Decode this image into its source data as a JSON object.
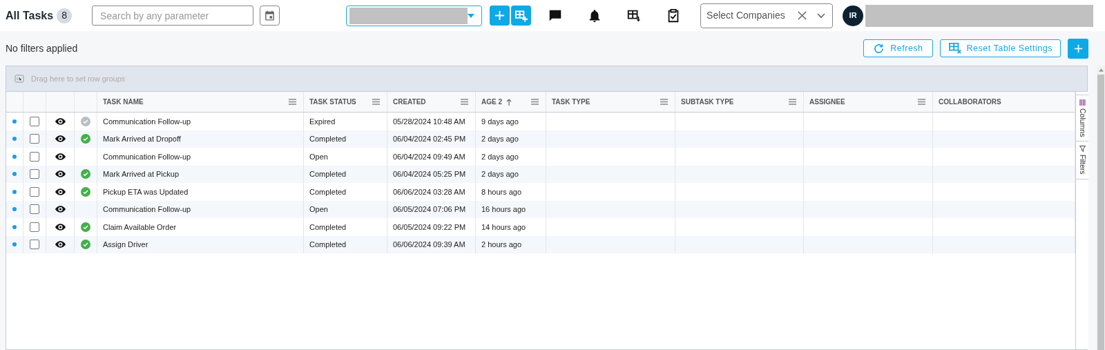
{
  "header": {
    "title": "All Tasks",
    "count": "8",
    "search": {
      "placeholder": "Search by any parameter"
    },
    "companies": {
      "placeholder": "Select Companies"
    },
    "avatar": "IR"
  },
  "toolbar": {
    "filter_status": "No filters applied",
    "buttons": [
      "Refresh",
      "Reset Table Settings"
    ]
  },
  "grid": {
    "group_hint": "Drag here to set row groups",
    "columns": [
      {
        "label": "TASK NAME",
        "sorted": false,
        "menu": true
      },
      {
        "label": "TASK STATUS",
        "sorted": false,
        "menu": true
      },
      {
        "label": "CREATED",
        "sorted": false,
        "menu": true
      },
      {
        "label": "AGE 2",
        "sorted": true,
        "menu": true
      },
      {
        "label": "TASK TYPE",
        "sorted": false,
        "menu": true
      },
      {
        "label": "SUBTASK TYPE",
        "sorted": false,
        "menu": true
      },
      {
        "label": "ASSIGNEE",
        "sorted": false,
        "menu": true
      },
      {
        "label": "COLLABORATORS",
        "sorted": false,
        "menu": false
      }
    ],
    "rows": [
      {
        "checked": false,
        "kind": "expired",
        "cells": [
          "Communication Follow-up",
          "Expired",
          "05/28/2024 10:48 AM",
          "9 days ago"
        ]
      },
      {
        "checked": false,
        "kind": "done",
        "cells": [
          "Mark Arrived at Dropoff",
          "Completed",
          "06/04/2024 02:45 PM",
          "2 days ago"
        ]
      },
      {
        "checked": false,
        "kind": "none",
        "cells": [
          "Communication Follow-up",
          "Open",
          "06/04/2024 09:49 AM",
          "2 days ago"
        ]
      },
      {
        "checked": false,
        "kind": "done",
        "cells": [
          "Mark Arrived at Pickup",
          "Completed",
          "06/04/2024 05:25 PM",
          "2 days ago"
        ]
      },
      {
        "checked": false,
        "kind": "done",
        "cells": [
          "Pickup ETA was Updated",
          "Completed",
          "06/06/2024 03:28 AM",
          "8 hours ago"
        ]
      },
      {
        "checked": false,
        "kind": "none",
        "cells": [
          "Communication Follow-up",
          "Open",
          "06/05/2024 07:06 PM",
          "16 hours ago"
        ]
      },
      {
        "checked": false,
        "kind": "done",
        "cells": [
          "Claim Available Order",
          "Completed",
          "06/05/2024 09:22 PM",
          "14 hours ago"
        ]
      },
      {
        "checked": false,
        "kind": "done",
        "cells": [
          "Assign Driver",
          "Completed",
          "06/06/2024 09:39 AM",
          "2 hours ago"
        ]
      }
    ],
    "side_tabs": [
      "Columns",
      "Filters"
    ]
  }
}
